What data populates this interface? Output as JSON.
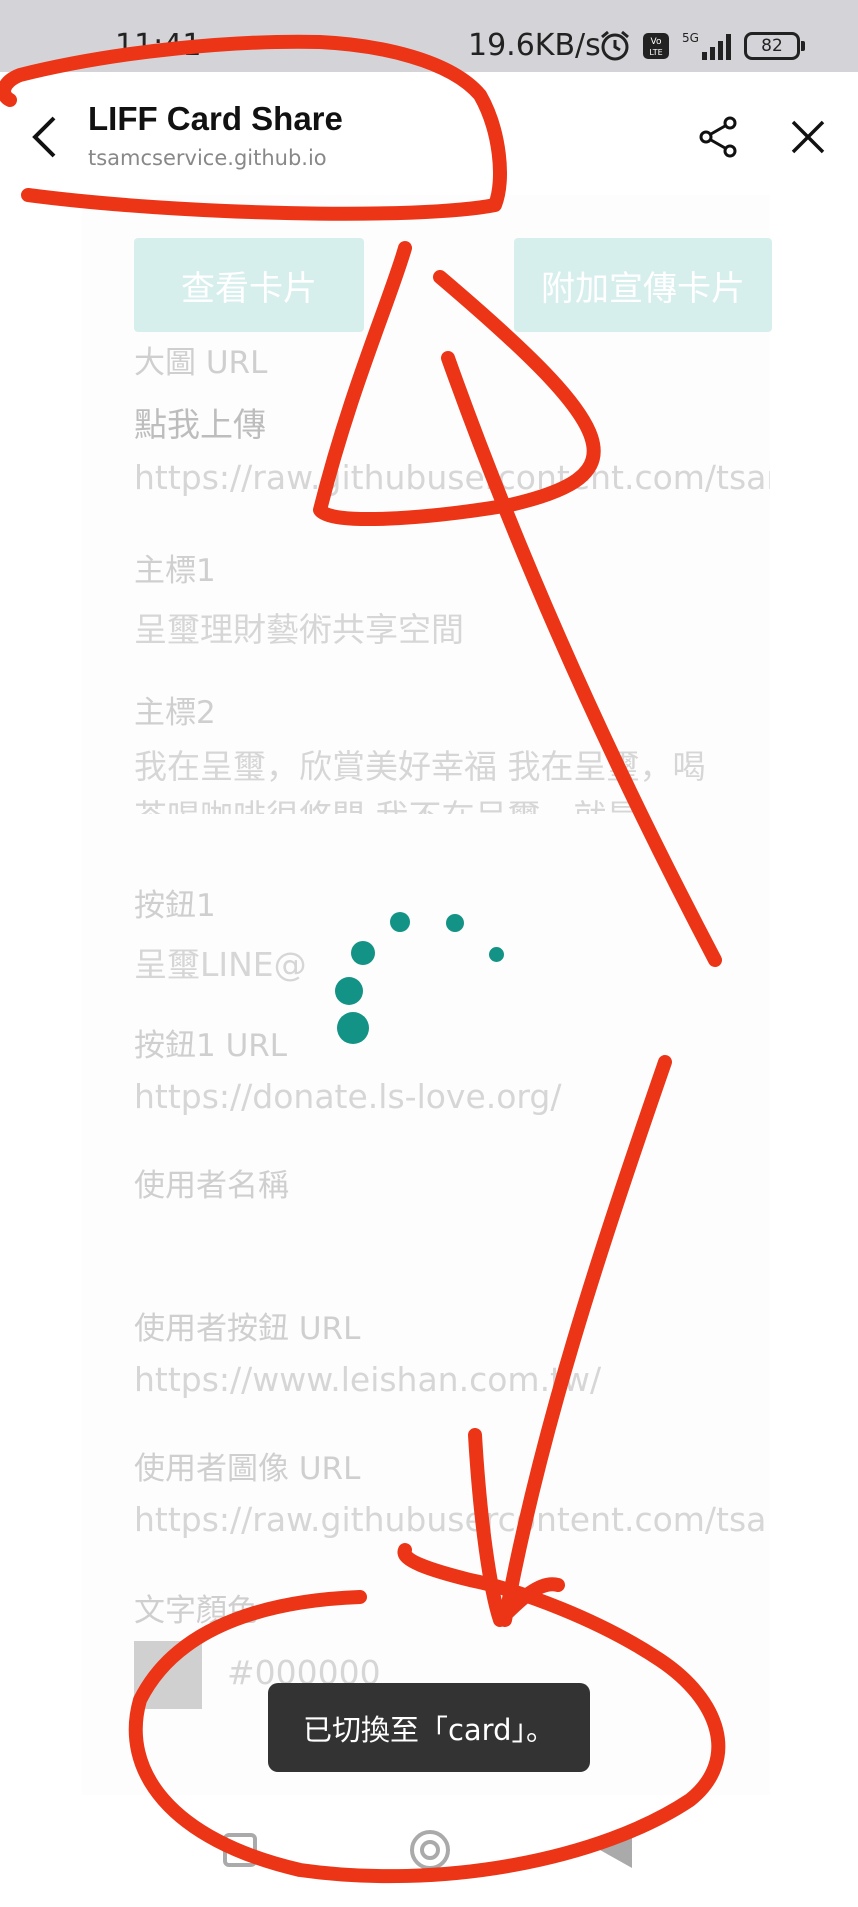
{
  "status_bar": {
    "time": "11:41",
    "speed": "19.6KB/s",
    "battery": "82",
    "icons": [
      "alarm-icon",
      "volte-icon",
      "5g-signal-icon",
      "battery-icon"
    ]
  },
  "header": {
    "title": "LIFF Card Share",
    "subtitle": "tsamcservice.github.io"
  },
  "buttons": {
    "view_card": "查看卡片",
    "add_promo_card": "附加宣傳卡片"
  },
  "form": {
    "big_image_label": "大圖 URL",
    "upload_link": "點我上傳",
    "big_image_value": "https://raw.githubusercontent.com/tsamcservice",
    "title1_label": "主標1",
    "title1_value": "呈璽理財藝術共享空間",
    "title2_label": "主標2",
    "title2_value": "我在呈璽，欣賞美好幸福 我在呈璽，喝茶喝咖啡很悠閒 我不在呈璽，就是",
    "button1_label": "按鈕1",
    "button1_value": "呈璽LINE@",
    "button1_url_label": "按鈕1 URL",
    "button1_url_value": "https://donate.ls-love.org/",
    "username_label": "使用者名稱",
    "username_value": "",
    "user_button_url_label": "使用者按鈕 URL",
    "user_button_url_value": "https://www.leishan.com.tw/",
    "user_image_url_label": "使用者圖像 URL",
    "user_image_url_value": "https://raw.githubusercontent.com/tsa",
    "text_color_label": "文字顏色",
    "text_color_value": "#000000"
  },
  "toast": {
    "message": "已切換至「card」。"
  },
  "annotation_color": "#ec3416",
  "spinner_color": "#139385"
}
